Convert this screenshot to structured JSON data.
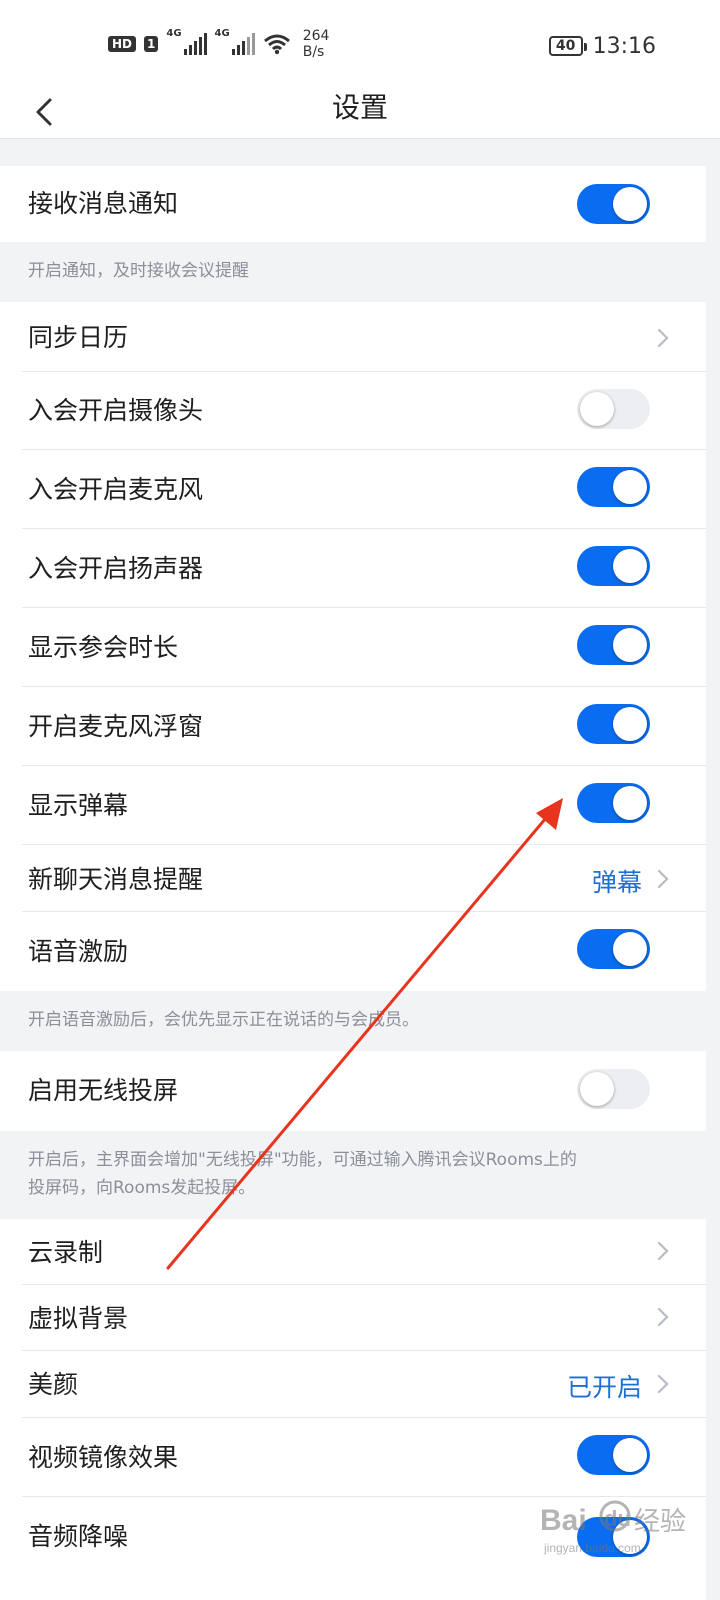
{
  "status_bar": {
    "hd": "HD",
    "sim": "1",
    "net1": "4G",
    "net2": "4G",
    "speed_value": "264",
    "speed_unit": "B/s",
    "battery": "40",
    "time": "13:16",
    "icons": [
      "signal-icon",
      "wifi-icon",
      "battery-icon"
    ]
  },
  "header": {
    "title": "设置",
    "back_icon": "chevron-left-icon"
  },
  "settings": {
    "receive_notify": {
      "label": "接收消息通知",
      "enabled": true
    },
    "receive_notify_desc": "开启通知，及时接收会议提醒",
    "sync_calendar": {
      "label": "同步日历"
    },
    "join_camera": {
      "label": "入会开启摄像头",
      "enabled": false
    },
    "join_mic": {
      "label": "入会开启麦克风",
      "enabled": true
    },
    "join_speaker": {
      "label": "入会开启扬声器",
      "enabled": true
    },
    "show_duration": {
      "label": "显示参会时长",
      "enabled": true
    },
    "mic_float": {
      "label": "开启麦克风浮窗",
      "enabled": true
    },
    "show_danmaku": {
      "label": "显示弹幕",
      "enabled": true
    },
    "new_chat_reminder": {
      "label": "新聊天消息提醒",
      "value": "弹幕"
    },
    "voice_incentive": {
      "label": "语音激励",
      "enabled": true
    },
    "voice_incentive_desc": "开启语音激励后，会优先显示正在说话的与会成员。",
    "wireless_cast": {
      "label": "启用无线投屏",
      "enabled": false
    },
    "wireless_cast_desc_line1": "开启后，主界面会增加\"无线投屏\"功能，可通过输入腾讯会议Rooms上的",
    "wireless_cast_desc_line2": "投屏码，向Rooms发起投屏。",
    "cloud_record": {
      "label": "云录制"
    },
    "virtual_bg": {
      "label": "虚拟背景"
    },
    "beauty": {
      "label": "美颜",
      "value": "已开启"
    },
    "video_mirror": {
      "label": "视频镜像效果",
      "enabled": true
    },
    "audio_denoise": {
      "label": "音频降噪",
      "enabled": true
    }
  },
  "colors": {
    "toggle_on": "#0a6cf0",
    "toggle_off": "#eceef1",
    "value_text": "#1d6fd6",
    "annotation_arrow": "#e8341c"
  },
  "watermark": {
    "text": "Bai du 经验",
    "subtext": "jingyan.baidu.com"
  }
}
